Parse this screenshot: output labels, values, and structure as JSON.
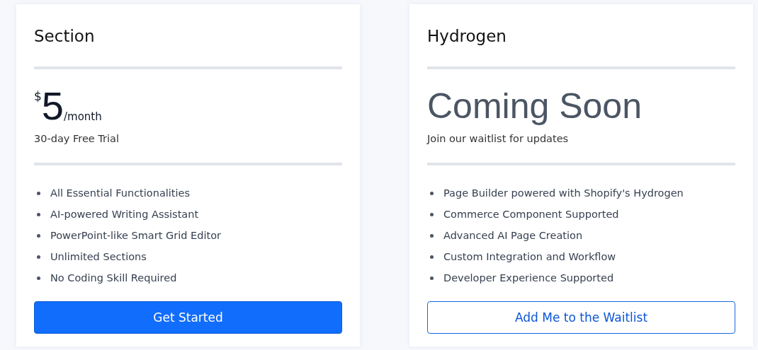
{
  "plans": [
    {
      "name": "Section",
      "offer": {
        "kind": "price",
        "currency": "$",
        "amount": "5",
        "period": "/month"
      },
      "subtitle": "30-day Free Trial",
      "features": [
        "All Essential Functionalities",
        "AI-powered Writing Assistant",
        "PowerPoint-like Smart Grid Editor",
        "Unlimited Sections",
        "No Coding Skill Required"
      ],
      "button": {
        "label": "Get Started",
        "kind": "primary"
      }
    },
    {
      "name": "Hydrogen",
      "offer": {
        "kind": "headline",
        "text": "Coming Soon"
      },
      "subtitle": "Join our waitlist for updates",
      "features": [
        "Page Builder powered with Shopify's Hydrogen",
        "Commerce Component Supported",
        "Advanced AI Page Creation",
        "Custom Integration and Workflow",
        "Developer Experience Supported"
      ],
      "button": {
        "label": "Add Me to the Waitlist",
        "kind": "outline"
      }
    }
  ]
}
